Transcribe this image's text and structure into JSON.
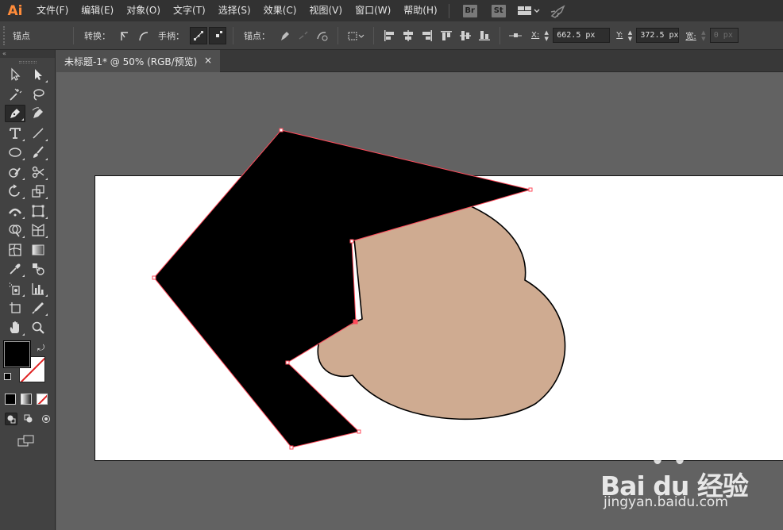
{
  "app": {
    "logo": "Ai"
  },
  "menu": {
    "items": [
      "文件(F)",
      "编辑(E)",
      "对象(O)",
      "文字(T)",
      "选择(S)",
      "效果(C)",
      "视图(V)",
      "窗口(W)",
      "帮助(H)"
    ],
    "bridge": "Br",
    "stock": "St"
  },
  "controlbar": {
    "anchor_label": "锚点",
    "convert_label": "转换：",
    "handles_label": "手柄：",
    "anchors_label": "锚点：",
    "x_label": "X:",
    "x_value": "662.5 px",
    "y_label": "Y:",
    "y_value": "372.5 px",
    "w_label": "宽:",
    "w_value": "0 px"
  },
  "toolpanel": {
    "collapse": "«"
  },
  "document": {
    "tab_title": "未标题-1* @ 50% (RGB/预览)",
    "close": "×"
  },
  "colors": {
    "fill": "#000000",
    "face": "#cfab91",
    "path_highlight": "#ff4a5a",
    "canvas": "#626262",
    "artboard": "#ffffff"
  },
  "watermark": {
    "brand": "Bai du 经验",
    "url": "jingyan.baidu.com"
  }
}
